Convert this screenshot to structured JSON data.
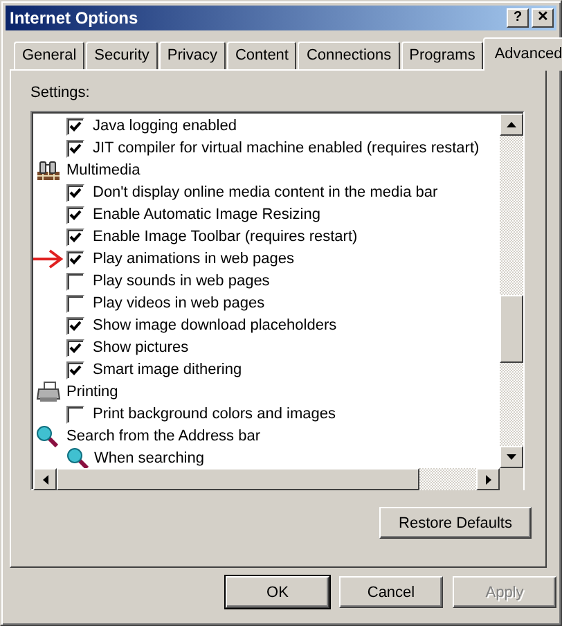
{
  "window": {
    "title": "Internet Options",
    "title_buttons": [
      "?",
      "✕"
    ]
  },
  "tabs": [
    {
      "label": "General",
      "selected": false
    },
    {
      "label": "Security",
      "selected": false
    },
    {
      "label": "Privacy",
      "selected": false
    },
    {
      "label": "Content",
      "selected": false
    },
    {
      "label": "Connections",
      "selected": false
    },
    {
      "label": "Programs",
      "selected": false
    },
    {
      "label": "Advanced",
      "selected": true
    }
  ],
  "settings": {
    "label": "Settings:",
    "items": [
      {
        "kind": "check",
        "label": "Java logging enabled",
        "checked": true,
        "marked": false
      },
      {
        "kind": "check",
        "label": "JIT compiler for virtual machine enabled (requires restart)",
        "checked": true,
        "marked": false
      },
      {
        "kind": "media",
        "label": "Multimedia"
      },
      {
        "kind": "check",
        "label": "Don't display online media content in the media bar",
        "checked": true,
        "marked": false
      },
      {
        "kind": "check",
        "label": "Enable Automatic Image Resizing",
        "checked": true,
        "marked": false
      },
      {
        "kind": "check",
        "label": "Enable Image Toolbar (requires restart)",
        "checked": true,
        "marked": false
      },
      {
        "kind": "check",
        "label": "Play animations in web pages",
        "checked": true,
        "marked": true
      },
      {
        "kind": "check",
        "label": "Play sounds in web pages",
        "checked": false,
        "marked": false
      },
      {
        "kind": "check",
        "label": "Play videos in web pages",
        "checked": false,
        "marked": false
      },
      {
        "kind": "check",
        "label": "Show image download placeholders",
        "checked": true,
        "marked": false
      },
      {
        "kind": "check",
        "label": "Show pictures",
        "checked": true,
        "marked": false
      },
      {
        "kind": "check",
        "label": "Smart image dithering",
        "checked": true,
        "marked": false
      },
      {
        "kind": "printer",
        "label": "Printing"
      },
      {
        "kind": "check",
        "label": "Print background colors and images",
        "checked": false,
        "marked": false
      },
      {
        "kind": "search",
        "label": "Search from the Address bar"
      },
      {
        "kind": "subsearch",
        "label": "When searching"
      }
    ]
  },
  "restore_button": "Restore Defaults",
  "buttons": [
    {
      "label": "OK",
      "default": true,
      "disabled": false
    },
    {
      "label": "Cancel",
      "default": false,
      "disabled": false
    },
    {
      "label": "Apply",
      "default": false,
      "disabled": true
    }
  ]
}
